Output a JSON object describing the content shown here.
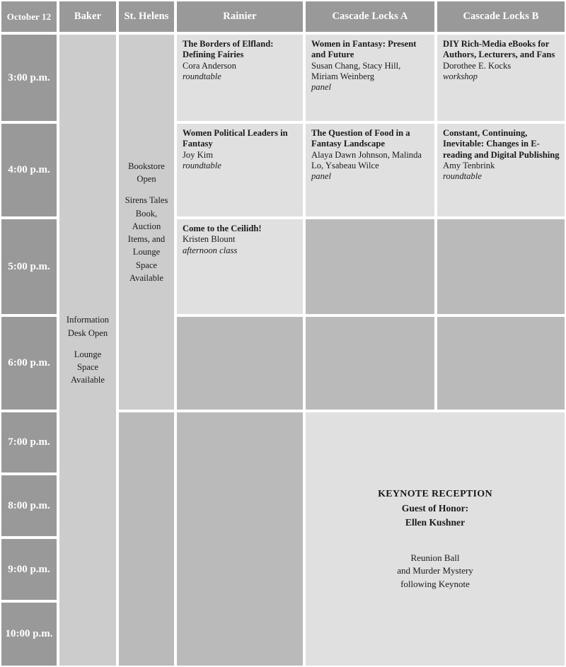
{
  "header": {
    "date_label": "October 12",
    "rooms": [
      "Baker",
      "St. Helens",
      "Rainier",
      "Cascade Locks A",
      "Cascade Locks B"
    ]
  },
  "times": [
    "3:00 p.m.",
    "4:00 p.m.",
    "5:00 p.m.",
    "6:00 p.m.",
    "7:00 p.m.",
    "8:00 p.m.",
    "9:00 p.m.",
    "10:00 p.m."
  ],
  "baker": {
    "line1": "Information",
    "line2": "Desk Open",
    "line3": "Lounge Space",
    "line4": "Available"
  },
  "sthelens": {
    "line1": "Bookstore",
    "line2": "Open",
    "line3": "Sirens Tales",
    "line4": "Book, Auction",
    "line5": "Items, and",
    "line6": "Lounge Space",
    "line7": "Available"
  },
  "sessions": {
    "rainier_3": {
      "title": "The Borders of Elfland: Defining Fairies",
      "people": "Cora Anderson",
      "kind": "roundtable"
    },
    "rainier_4": {
      "title": "Women Political Leaders in Fantasy",
      "people": "Joy Kim",
      "kind": "roundtable"
    },
    "rainier_5": {
      "title": "Come to the Ceilidh!",
      "people": "Kristen Blount",
      "kind": "afternoon class"
    },
    "cascade_a_3": {
      "title": "Women in Fantasy: Present and Future",
      "people": "Susan Chang, Stacy Hill, Miriam Weinberg",
      "kind": "panel"
    },
    "cascade_a_4": {
      "title": "The Question of Food in a Fantasy Landscape",
      "people": "Alaya Dawn Johnson, Malinda Lo, Ysabeau Wilce",
      "kind": "panel"
    },
    "cascade_b_3": {
      "title": "DIY Rich-Media eBooks for Authors, Lecturers, and Fans",
      "people": "Dorothee E. Kocks",
      "kind": "workshop"
    },
    "cascade_b_4": {
      "title": "Constant, Continuing, Inevitable: Changes in E-reading and Digital Publishing",
      "people": "Amy Tenbrink",
      "kind": "roundtable"
    }
  },
  "keynote": {
    "heading": "KEYNOTE RECEPTION",
    "guest_label": "Guest of Honor:",
    "guest_name": "Ellen Kushner",
    "sub_line1": "Reunion Ball",
    "sub_line2": "and Murder Mystery",
    "sub_line3": "following Keynote"
  },
  "colors": {
    "header_bg": "#999999",
    "header_text": "#ffffff",
    "session_bg": "#e0e0e0",
    "info_bg": "#cccccc",
    "blank_bg": "#bababa",
    "page_bg": "#ffffff",
    "body_text": "#1a1a1a"
  }
}
